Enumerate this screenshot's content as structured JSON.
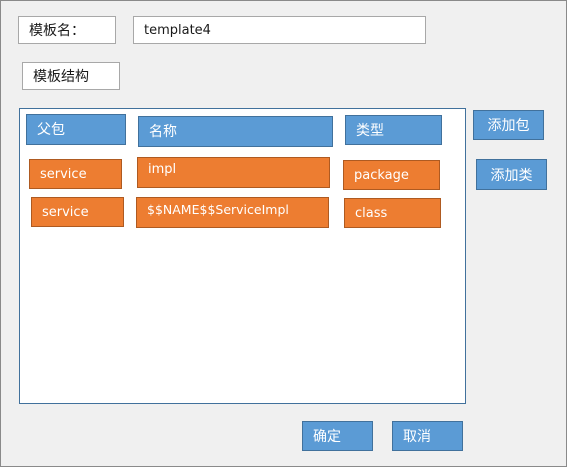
{
  "form": {
    "template_name_label": "模板名：",
    "template_name_value": "template4",
    "structure_label": "模板结构"
  },
  "table": {
    "headers": {
      "parent": "父包",
      "name": "名称",
      "type": "类型"
    },
    "rows": [
      {
        "parent": "service",
        "name": "impl",
        "type": "package"
      },
      {
        "parent": "service",
        "name": "$$NAME$$ServiceImpl",
        "type": "class"
      }
    ]
  },
  "actions": {
    "add_package": "添加包",
    "add_class": "添加类",
    "confirm": "确定",
    "cancel": "取消"
  },
  "colors": {
    "header_blue": "#5b9bd5",
    "row_orange": "#ed7d31",
    "panel_border": "#41719c"
  }
}
